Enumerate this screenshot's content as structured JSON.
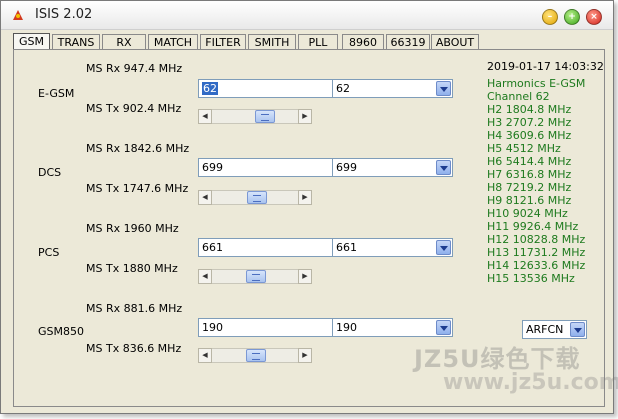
{
  "window": {
    "title": "ISIS 2.02"
  },
  "tabs": [
    {
      "label": "GSM",
      "active": true
    },
    {
      "label": "TRANS"
    },
    {
      "label": "RX"
    },
    {
      "label": "MATCH"
    },
    {
      "label": "FILTER"
    },
    {
      "label": "SMITH"
    },
    {
      "label": "PLL"
    },
    {
      "label": "8960"
    },
    {
      "label": "66319"
    },
    {
      "label": "ABOUT"
    }
  ],
  "bands": [
    {
      "name": "E-GSM",
      "rx": "MS Rx  947.4  MHz",
      "tx": "MS Tx  902.4  MHz",
      "channel_value": "62",
      "channel_select": "62",
      "slider_level": 0.5
    },
    {
      "name": "DCS",
      "rx": "MS Rx  1842.6  MHz",
      "tx": "MS Tx  1747.6  MHz",
      "channel_value": "699",
      "channel_select": "699",
      "slider_level": 0.5
    },
    {
      "name": "PCS",
      "rx": "MS Rx  1960  MHz",
      "tx": "MS Tx  1880  MHz",
      "channel_value": "661",
      "channel_select": "661",
      "slider_level": 0.5
    },
    {
      "name": "GSM850",
      "rx": "MS Rx  881.6  MHz",
      "tx": "MS Tx  836.6  MHz",
      "channel_value": "190",
      "channel_select": "190",
      "slider_level": 0.5
    }
  ],
  "timestamp": "2019-01-17 14:03:32",
  "harmonics": [
    "Harmonics E-GSM",
    "Channel 62",
    "H2 1804.8 MHz",
    "H3 2707.2 MHz",
    "H4 3609.6 MHz",
    "H5 4512 MHz",
    "H6 5414.4 MHz",
    "H7 6316.8 MHz",
    "H8 7219.2 MHz",
    "H9 8121.6 MHz",
    "H10 9024 MHz",
    "H11 9926.4 MHz",
    "H12 10828.8 MHz",
    "H13 11731.2 MHz",
    "H14 12633.6 MHz",
    "H15 13536 MHz"
  ],
  "mode_select": "ARFCN",
  "watermark": {
    "line1": "JZ5U绿色下载",
    "line2": "www.jz5u.com"
  }
}
